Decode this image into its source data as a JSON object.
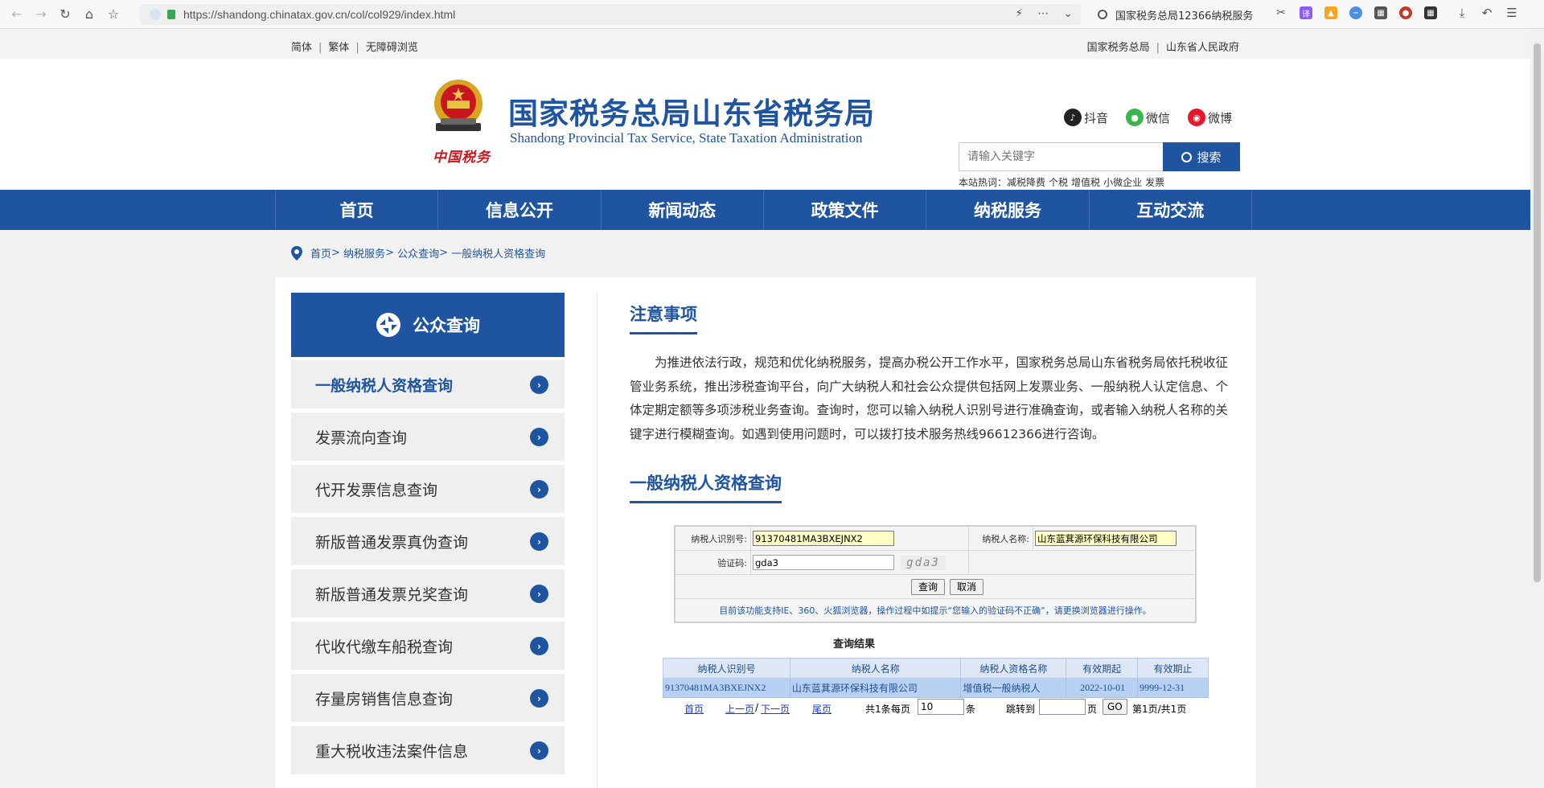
{
  "browser": {
    "url": "https://shandong.chinatax.gov.cn/col/col929/index.html",
    "search_text": "国家税务总局12366纳税服务"
  },
  "topbar": {
    "simplified": "简体",
    "traditional": "繁体",
    "accessible": "无障碍浏览",
    "link_sat": "国家税务总局",
    "link_gov": "山东省人民政府"
  },
  "header": {
    "title": "国家税务总局山东省税务局",
    "subtitle": "Shandong Provincial Tax Service, State Taxation Administration",
    "emblem_caption": "中国税务",
    "social": [
      {
        "label": "抖音",
        "icon": "douyin-icon",
        "color": "#222222"
      },
      {
        "label": "微信",
        "icon": "wechat-icon",
        "color": "#3bb44a"
      },
      {
        "label": "微博",
        "icon": "weibo-icon",
        "color": "#e6162d"
      }
    ],
    "search_placeholder": "请输入关键字",
    "search_button": "搜索",
    "hotwords_label": "本站热词：",
    "hotwords": [
      "减税降费",
      "个税",
      "增值税",
      "小微企业",
      "发票"
    ]
  },
  "nav": {
    "items": [
      "首页",
      "信息公开",
      "新闻动态",
      "政策文件",
      "纳税服务",
      "互动交流"
    ]
  },
  "breadcrumb": [
    "首页",
    "纳税服务",
    "公众查询",
    "一般纳税人资格查询"
  ],
  "sidebar": {
    "title": "公众查询",
    "items": [
      {
        "label": "一般纳税人资格查询",
        "active": true
      },
      {
        "label": "发票流向查询",
        "active": false
      },
      {
        "label": "代开发票信息查询",
        "active": false
      },
      {
        "label": "新版普通发票真伪查询",
        "active": false
      },
      {
        "label": "新版普通发票兑奖查询",
        "active": false
      },
      {
        "label": "代收代缴车船税查询",
        "active": false
      },
      {
        "label": "存量房销售信息查询",
        "active": false
      },
      {
        "label": "重大税收违法案件信息",
        "active": false
      }
    ]
  },
  "notice": {
    "title": "注意事项",
    "text": "为推进依法行政，规范和优化纳税服务，提高办税公开工作水平，国家税务总局山东省税务局依托税收征管业务系统，推出涉税查询平台，向广大纳税人和社会公众提供包括网上发票业务、一般纳税人认定信息、个体定期定额等多项涉税业务查询。查询时，您可以输入纳税人识别号进行准确查询，或者输入纳税人名称的关键字进行模糊查询。如遇到使用问题时，可以拨打技术服务热线96612366进行咨询。"
  },
  "query": {
    "title": "一般纳税人资格查询",
    "taxpayer_id_label": "纳税人识别号:",
    "taxpayer_id_value": "91370481MA3BXEJNX2",
    "taxpayer_name_label": "纳税人名称:",
    "taxpayer_name_value": "山东蓝萁源环保科技有限公司",
    "captcha_label": "验证码:",
    "captcha_value": "gda3",
    "captcha_image_text": "gda3",
    "query_button": "查询",
    "cancel_button": "取消",
    "note": "目前该功能支持IE、360、火狐浏览器，操作过程中如提示“您输入的验证码不正确”，请更换浏览器进行操作。"
  },
  "results": {
    "title": "查询结果",
    "columns": [
      "纳税人识别号",
      "纳税人名称",
      "纳税人资格名称",
      "有效期起",
      "有效期止"
    ],
    "rows": [
      [
        "91370481MA3BXEJNX2",
        "山东蓝萁源环保科技有限公司",
        "增值税一般纳税人",
        "2022-10-01",
        "9999-12-31"
      ]
    ]
  },
  "pager": {
    "first": "首页",
    "prev": "上一页",
    "slash": "/",
    "next": "下一页",
    "last": "尾页",
    "total": "共1条",
    "per_page_label": "每页",
    "per_page_value": "10",
    "per_page_unit": "条",
    "jump_label": "跳转到",
    "jump_unit": "页",
    "go_button": "GO",
    "page_info": "第1页/共1页"
  }
}
